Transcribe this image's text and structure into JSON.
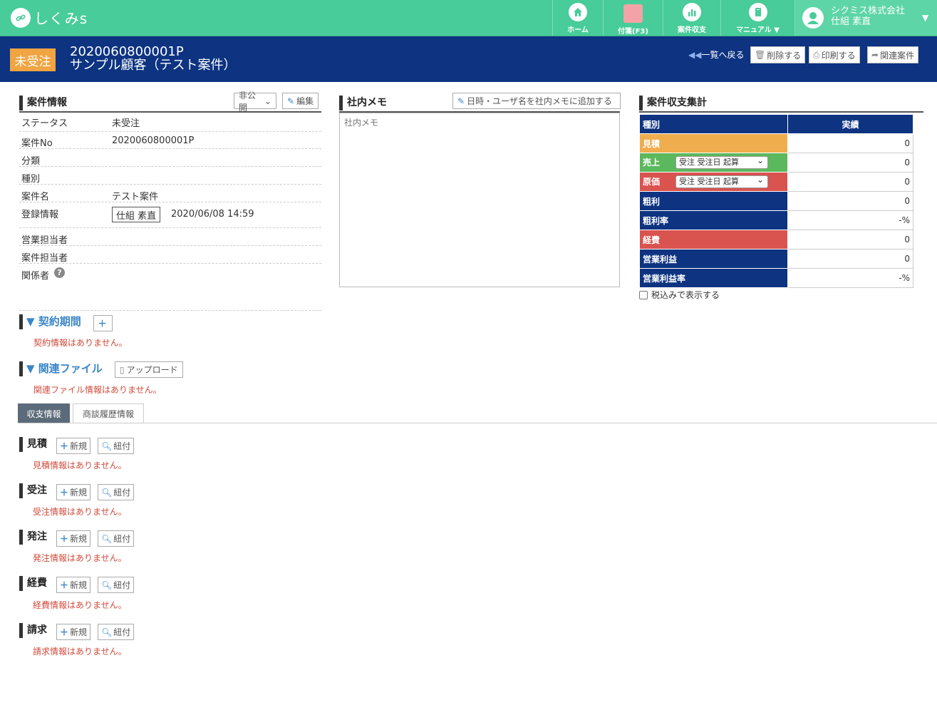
{
  "app": {
    "logo_text": "しくみs"
  },
  "nav": [
    {
      "label": "ホーム",
      "icon": "home-icon"
    },
    {
      "label": "付箋(F3)",
      "icon": "sticky-note-icon"
    },
    {
      "label": "案件収支",
      "icon": "chart-icon"
    },
    {
      "label": "マニュアル ▼",
      "icon": "manual-icon"
    }
  ],
  "user": {
    "company": "シクミス株式会社",
    "name": "仕組 素直"
  },
  "header": {
    "status": "未受注",
    "case_no": "2020060800001P",
    "case_name": "サンプル顧客（テスト案件）",
    "back_label": "一覧へ戻る",
    "delete_label": "削除する",
    "print_label": "印刷する",
    "related_label": "関連案件"
  },
  "case_info": {
    "title": "案件情報",
    "visibility": "非公開",
    "edit_label": "編集",
    "rows": [
      {
        "k": "ステータス",
        "v": "未受注"
      },
      {
        "k": "案件No",
        "v": "2020060800001P"
      },
      {
        "k": "分類",
        "v": ""
      },
      {
        "k": "種別",
        "v": ""
      },
      {
        "k": "案件名",
        "v": "テスト案件"
      },
      {
        "k": "登録情報",
        "v": "2020/06/08 14:59",
        "user": "仕組 素直"
      },
      {
        "k": "営業担当者",
        "v": ""
      },
      {
        "k": "案件担当者",
        "v": ""
      },
      {
        "k": "関係者",
        "v": ""
      }
    ]
  },
  "memo": {
    "title": "社内メモ",
    "add_label": "日時・ユーザ名を社内メモに追加する",
    "placeholder": "社内メモ"
  },
  "summary": {
    "title": "案件収支集計",
    "head_kind": "種別",
    "head_actual": "実績",
    "rows": [
      {
        "label": "見積",
        "value": "0",
        "color": "#f0ad4e"
      },
      {
        "label": "売上",
        "value": "0",
        "color": "#5cb85c",
        "select": "受注 受注日 起算"
      },
      {
        "label": "原価",
        "value": "0",
        "color": "#d9534f",
        "select": "受注 受注日 起算"
      },
      {
        "label": "粗利",
        "value": "0",
        "color": "#0d3381"
      },
      {
        "label": "粗利率",
        "value": "-%",
        "color": "#0d3381"
      },
      {
        "label": "経費",
        "value": "0",
        "color": "#d9534f"
      },
      {
        "label": "営業利益",
        "value": "0",
        "color": "#0d3381"
      },
      {
        "label": "営業利益率",
        "value": "-%",
        "color": "#0d3381"
      }
    ],
    "tax_label": "税込みで表示する"
  },
  "contract": {
    "title": "▼ 契約期間",
    "empty": "契約情報はありません。"
  },
  "files": {
    "title": "▼ 関連ファイル",
    "upload_label": "アップロード",
    "empty": "関連ファイル情報はありません。"
  },
  "tabs": [
    {
      "label": "収支情報"
    },
    {
      "label": "商談履歴情報"
    }
  ],
  "sections": [
    {
      "title": "見積",
      "new": "新規",
      "link": "紐付",
      "empty": "見積情報はありません。"
    },
    {
      "title": "受注",
      "new": "新規",
      "link": "紐付",
      "empty": "受注情報はありません。"
    },
    {
      "title": "発注",
      "new": "新規",
      "link": "紐付",
      "empty": "発注情報はありません。"
    },
    {
      "title": "経費",
      "new": "新規",
      "link": "紐付",
      "empty": "経費情報はありません。"
    },
    {
      "title": "請求",
      "new": "新規",
      "link": "紐付",
      "empty": "請求情報はありません。"
    }
  ]
}
